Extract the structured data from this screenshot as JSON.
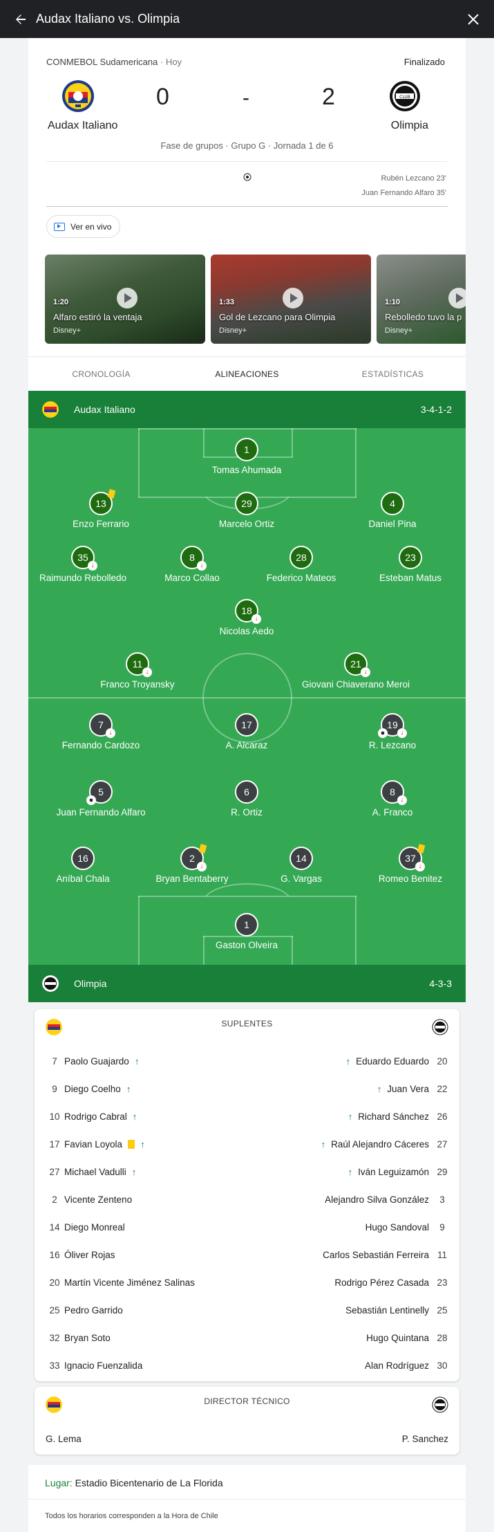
{
  "header": {
    "title": "Audax Italiano vs. Olimpia"
  },
  "match": {
    "competition": "CONMEBOL Sudamericana",
    "date": "· Hoy",
    "status": "Finalizado",
    "home": {
      "name": "Audax Italiano",
      "score": "0"
    },
    "away": {
      "name": "Olimpia",
      "score": "2"
    },
    "dash": "-",
    "phase": "Fase de grupos · Grupo G · Jornada 1 de 6",
    "scorers": [
      "Rubén Lezcano 23'",
      "Juan Fernando Alfaro 35'"
    ],
    "live_label": "Ver en vivo"
  },
  "videos": [
    {
      "duration": "1:20",
      "title": "Alfaro estiró la ventaja",
      "source": "Disney+"
    },
    {
      "duration": "1:33",
      "title": "Gol de Lezcano para Olimpia",
      "source": "Disney+"
    },
    {
      "duration": "1:10",
      "title": "Rebolledo tuvo la p",
      "source": "Disney+"
    }
  ],
  "tabs": [
    "CRONOLOGÍA",
    "ALINEACIONES",
    "ESTADÍSTICAS"
  ],
  "lineups": {
    "home": {
      "name": "Audax Italiano",
      "formation": "3-4-1-2"
    },
    "away": {
      "name": "Olimpia",
      "formation": "4-3-3"
    },
    "home_players": [
      {
        "num": "1",
        "name": "Tomas Ahumada"
      },
      {
        "num": "13",
        "name": "Enzo Ferrario"
      },
      {
        "num": "29",
        "name": "Marcelo Ortiz"
      },
      {
        "num": "4",
        "name": "Daniel Pina"
      },
      {
        "num": "35",
        "name": "Raimundo Rebolledo"
      },
      {
        "num": "8",
        "name": "Marco Collao"
      },
      {
        "num": "28",
        "name": "Federico Mateos"
      },
      {
        "num": "23",
        "name": "Esteban Matus"
      },
      {
        "num": "18",
        "name": "Nicolas Aedo"
      },
      {
        "num": "11",
        "name": "Franco Troyansky"
      },
      {
        "num": "21",
        "name": "Giovani Chiaverano Meroi"
      }
    ],
    "away_players": [
      {
        "num": "7",
        "name": "Fernando Cardozo"
      },
      {
        "num": "17",
        "name": "A. Alcaraz"
      },
      {
        "num": "19",
        "name": "R. Lezcano"
      },
      {
        "num": "5",
        "name": "Juan Fernando Alfaro"
      },
      {
        "num": "6",
        "name": "R. Ortiz"
      },
      {
        "num": "8",
        "name": "A. Franco"
      },
      {
        "num": "16",
        "name": "Aníbal Chala"
      },
      {
        "num": "2",
        "name": "Bryan Bentaberry"
      },
      {
        "num": "14",
        "name": "G. Vargas"
      },
      {
        "num": "37",
        "name": "Romeo Benitez"
      },
      {
        "num": "1",
        "name": "Gaston Olveira"
      }
    ]
  },
  "subs": {
    "title": "SUPLENTES",
    "rows": [
      {
        "lnum": "7",
        "lname": "Paolo Guajardo",
        "rnum": "20",
        "rname": "Eduardo Eduardo"
      },
      {
        "lnum": "9",
        "lname": "Diego Coelho",
        "rnum": "22",
        "rname": "Juan Vera"
      },
      {
        "lnum": "10",
        "lname": "Rodrigo Cabral",
        "rnum": "26",
        "rname": "Richard Sánchez"
      },
      {
        "lnum": "17",
        "lname": "Favian Loyola",
        "rnum": "27",
        "rname": "Raúl Alejandro Cáceres"
      },
      {
        "lnum": "27",
        "lname": "Michael Vadulli",
        "rnum": "29",
        "rname": "Iván Leguizamón"
      },
      {
        "lnum": "2",
        "lname": "Vicente Zenteno",
        "rnum": "3",
        "rname": "Alejandro Silva González"
      },
      {
        "lnum": "14",
        "lname": "Diego Monreal",
        "rnum": "9",
        "rname": "Hugo Sandoval"
      },
      {
        "lnum": "16",
        "lname": "Óliver Rojas",
        "rnum": "11",
        "rname": "Carlos Sebastián Ferreira"
      },
      {
        "lnum": "20",
        "lname": "Martín Vicente Jiménez Salinas",
        "rnum": "23",
        "rname": "Rodrigo Pérez Casada"
      },
      {
        "lnum": "25",
        "lname": "Pedro Garrido",
        "rnum": "25",
        "rname": "Sebastián Lentinelly"
      },
      {
        "lnum": "32",
        "lname": "Bryan Soto",
        "rnum": "28",
        "rname": "Hugo Quintana"
      },
      {
        "lnum": "33",
        "lname": "Ignacio Fuenzalida",
        "rnum": "30",
        "rname": "Alan Rodríguez"
      }
    ]
  },
  "coach": {
    "title": "DIRECTOR TÉCNICO",
    "home": "G. Lema",
    "away": "P. Sanchez"
  },
  "venue": {
    "label": "Lugar:",
    "value": "Estadio Bicentenario de La Florida"
  },
  "footer": "Todos los horarios corresponden a la Hora de Chile",
  "colors": {
    "pitch": "#34a853",
    "team_bar": "#188038",
    "accent": "#1a73e8",
    "yellow_card": "#fbcc0f"
  },
  "icons": {
    "back": "arrow-left-icon",
    "close": "close-icon",
    "ball": "soccer-ball-icon",
    "play": "play-icon",
    "live": "tv-icon"
  }
}
